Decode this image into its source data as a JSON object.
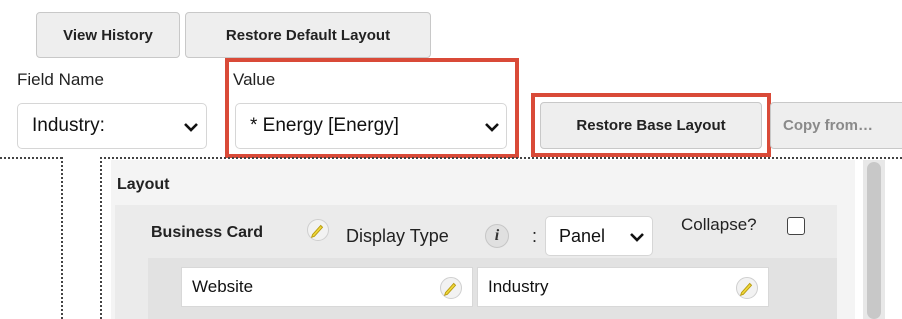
{
  "toolbar": {
    "view_history_label": "View History",
    "restore_default_label": "Restore Default Layout"
  },
  "field_name": {
    "label": "Field Name",
    "value": "Industry:"
  },
  "value_field": {
    "label": "Value",
    "value": "* Energy [Energy]"
  },
  "restore_base_label": "Restore Base Layout",
  "copy_from_label": "Copy from…",
  "layout": {
    "heading": "Layout",
    "panel": {
      "title": "Business Card",
      "display_type_label": "Display Type",
      "info_icon_glyph": "i",
      "colon": ":",
      "display_type_value": "Panel",
      "collapse_label": "Collapse?",
      "collapse_checked": false
    },
    "fields": [
      "Website",
      "Industry"
    ]
  },
  "colors": {
    "highlight": "#d94a38",
    "button_bg": "#eeeeee",
    "panel_bg": "#f4f4f4",
    "pencil_yellow": "#f0d83a"
  },
  "icons": {
    "edit": "pencil-icon",
    "info": "info-icon",
    "dropdown": "chevron-down-icon"
  }
}
